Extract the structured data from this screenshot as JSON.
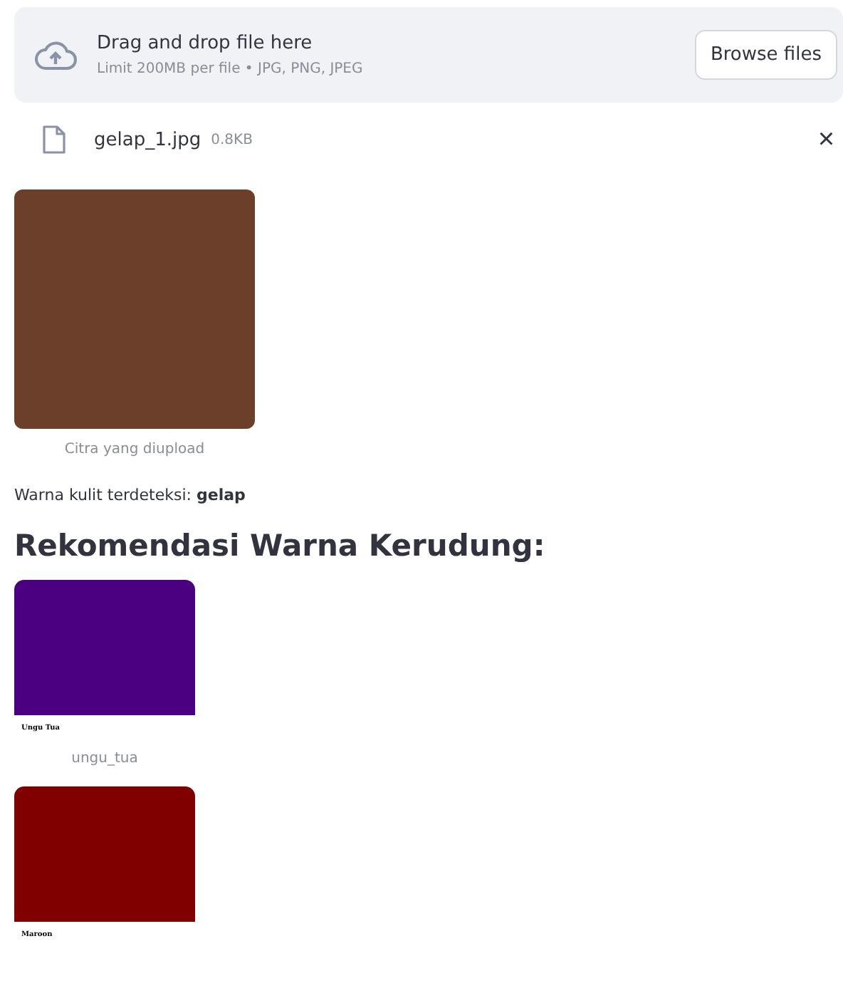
{
  "uploader": {
    "title": "Drag and drop file here",
    "limit": "Limit 200MB per file • JPG, PNG, JPEG",
    "button": "Browse files"
  },
  "file": {
    "name": "gelap_1.jpg",
    "size": "0.8KB",
    "close": "×"
  },
  "uploaded_image": {
    "color": "#6b3f2a",
    "caption": "Citra yang diupload"
  },
  "result": "Warna kulit terdeteksi: **gelap**",
  "heading": "Rekomendasi Warna Kerudung:",
  "recommendations": [
    {
      "color": "#4b0082",
      "label": "Ungu Tua",
      "caption": "ungu_tua"
    },
    {
      "color": "#800000",
      "label": "Maroon"
    }
  ]
}
